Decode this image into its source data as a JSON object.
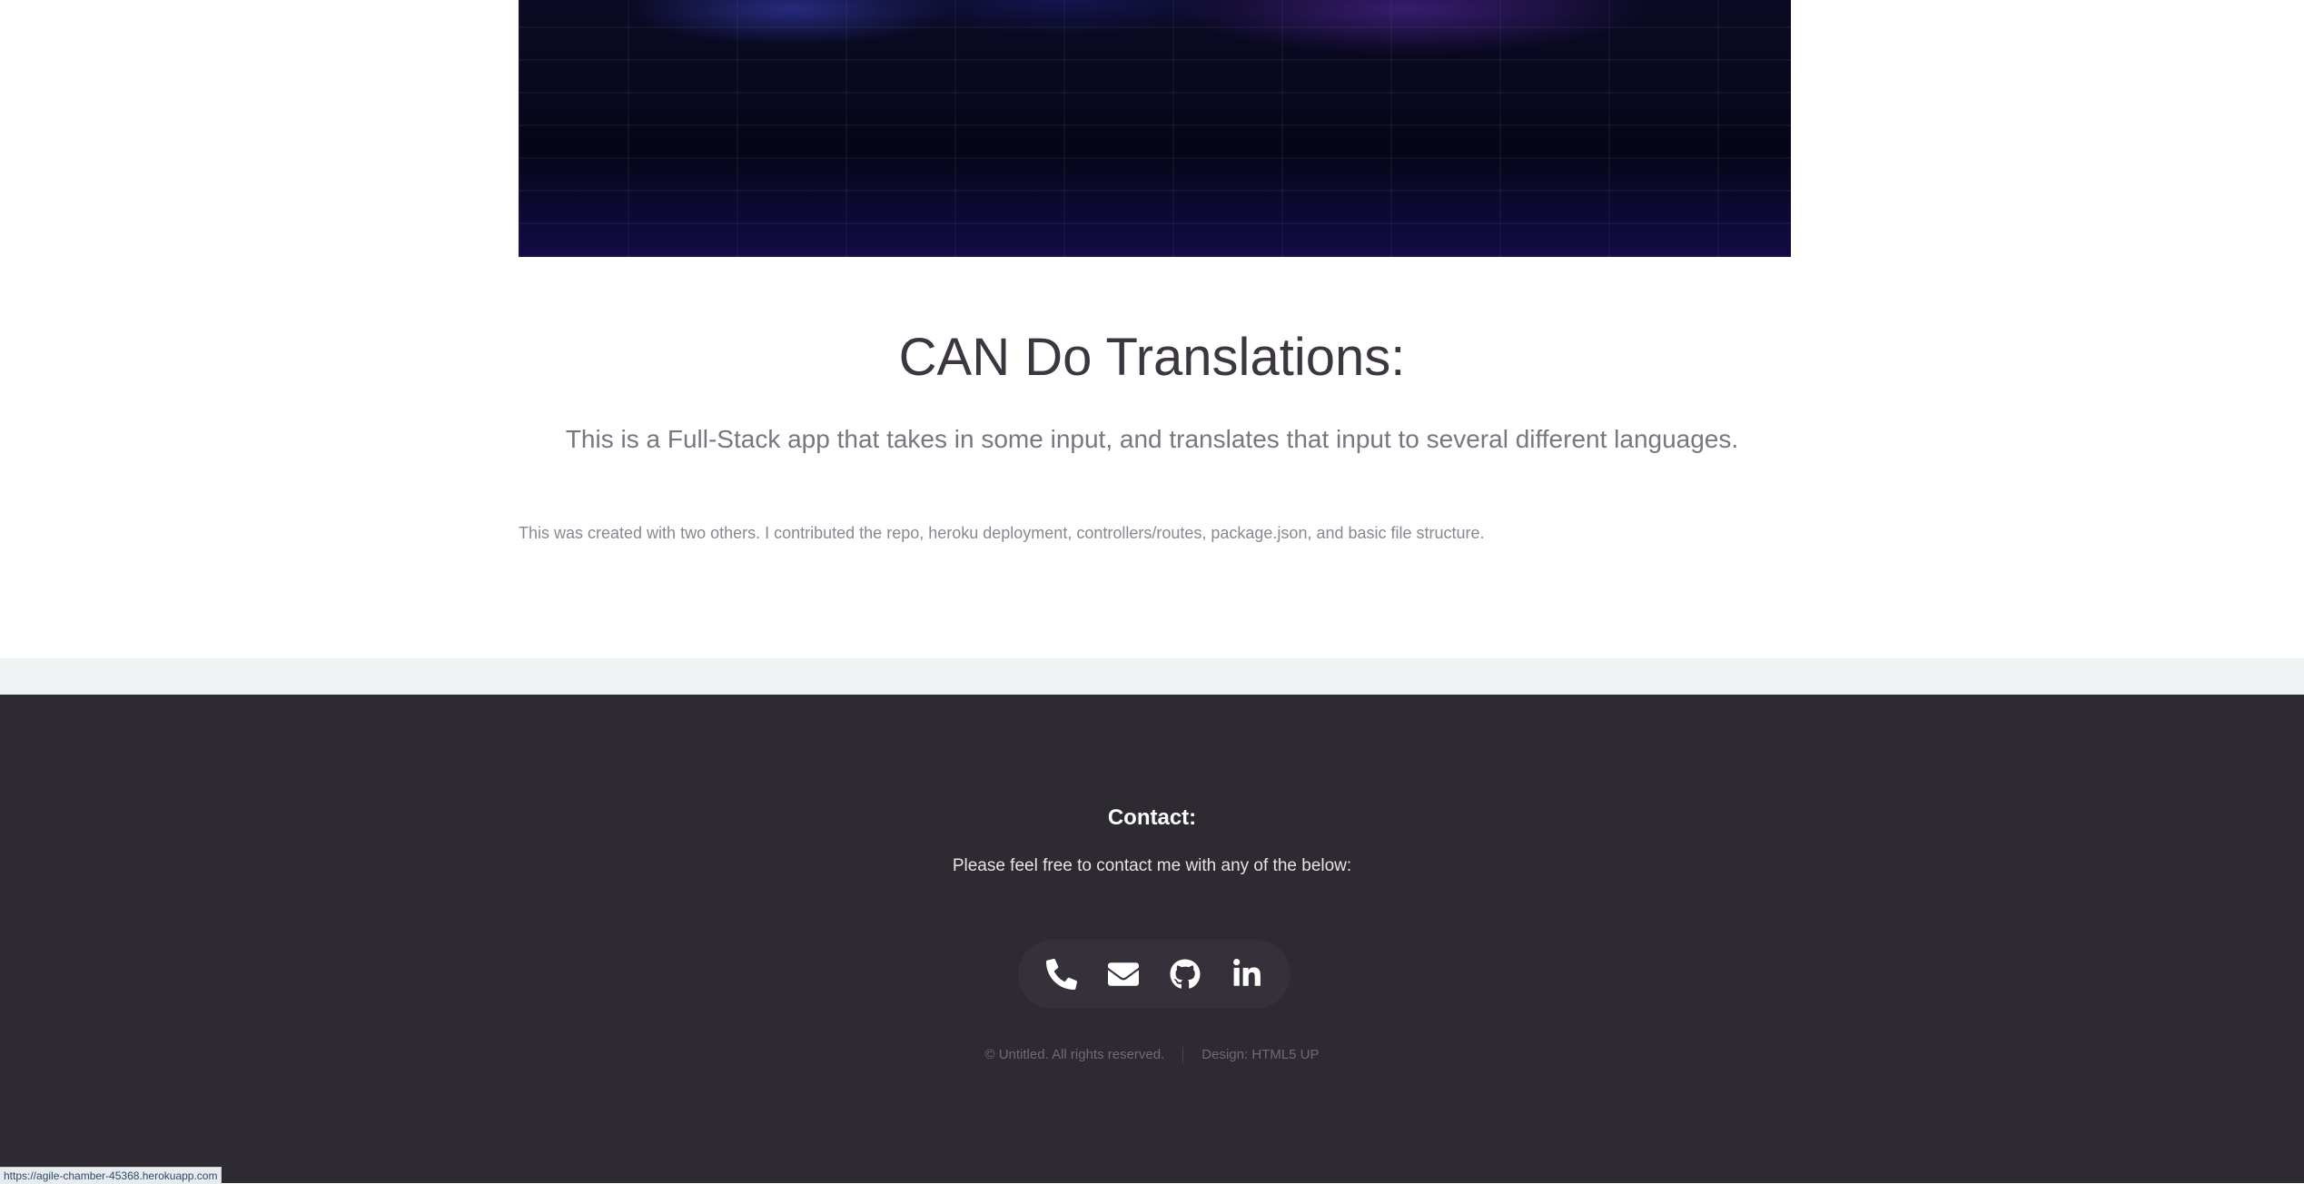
{
  "project": {
    "title": "CAN Do Translations:",
    "subtitle": "This is a Full-Stack app that takes in some input, and translates that input to several different languages.",
    "note": "This was created with two others. I contributed the repo, heroku deployment, controllers/routes, package.json, and basic file structure."
  },
  "footer": {
    "contact_title": "Contact:",
    "contact_text": "Please feel free to contact me with any of the below:",
    "icons": [
      "phone-icon",
      "envelope-icon",
      "github-icon",
      "linkedin-icon"
    ],
    "copyright": "© Untitled. All rights reserved.",
    "design_credit": "Design: HTML5 UP"
  },
  "status_bar": {
    "url": "https://agile-chamber-45368.herokuapp.com"
  },
  "colors": {
    "footer_bg": "#2e2a31",
    "band_bg": "#eef2f3",
    "title": "#3c3640"
  }
}
